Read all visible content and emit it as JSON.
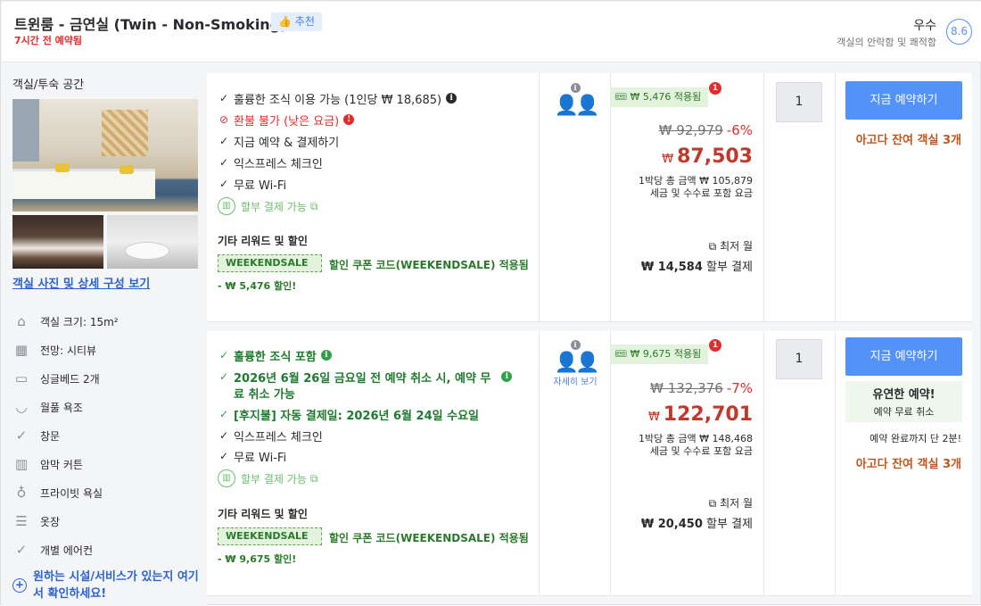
{
  "header": {
    "room_title": "트윈룸 - 금연실 (Twin - Non-Smoking)",
    "recommend_label": "추천",
    "booked_text": "7시간 전 예약됨",
    "score_word": "우수",
    "score_desc": "객실의 안락함 및 쾌적함",
    "score_value": "8.6"
  },
  "sidebar": {
    "title": "객실/투숙 공간",
    "see_photos": "객실 사진 및 상세 구성 보기",
    "features": [
      {
        "icon": "house-icon",
        "label": "객실 크기: 15m²"
      },
      {
        "icon": "city-view-icon",
        "label": "전망: 시티뷰"
      },
      {
        "icon": "bed-icon",
        "label": "싱글베드 2개"
      },
      {
        "icon": "bathtub-icon",
        "label": "월풀 욕조"
      },
      {
        "icon": "check-circle-icon",
        "label": "창문"
      },
      {
        "icon": "curtain-icon",
        "label": "암막 커튼"
      },
      {
        "icon": "toilet-icon",
        "label": "프라이빗 욕실"
      },
      {
        "icon": "wardrobe-icon",
        "label": "옷장"
      },
      {
        "icon": "check-circle-icon",
        "label": "개별 에어컨"
      }
    ],
    "ask_text": "원하는 시설/서비스가 있는지 여기서 확인하세요!"
  },
  "offers": [
    {
      "benefits": [
        {
          "mark": "✓",
          "text": "훌륭한 조식 이용 가능 (1인당 ₩ 18,685)",
          "style": "normal",
          "info": "dark"
        },
        {
          "mark": "⊘",
          "text": "환불 불가 (낮은 요금)",
          "style": "red",
          "info": "red"
        },
        {
          "mark": "✓",
          "text": "지금 예약 & 결제하기",
          "style": "normal",
          "info": ""
        },
        {
          "mark": "✓",
          "text": "익스프레스 체크인",
          "style": "normal",
          "info": ""
        },
        {
          "mark": "✓",
          "text": "무료 Wi-Fi",
          "style": "normal",
          "info": ""
        }
      ],
      "installment": "할부 결제 가능",
      "other_rewards": "기타 리워드 및 할인",
      "coupon_code": "WEEKENDSALE",
      "coupon_text": "할인 쿠폰 코드(WEEKENDSALE) 적용됨",
      "discount_text": "- ₩ 5,476 할인!",
      "occupancy_detail": "",
      "promo_label": "₩ 5,476 적용됨",
      "promo_count": "1",
      "original_price": "₩ 92,979",
      "discount_pct": "-6%",
      "currency": "₩",
      "price": "87,503",
      "price_note_1": "1박당 총 금액 ₩ 105,879",
      "price_note_2": "세금 및 수수료 포함 요금",
      "monthly_label": "최저 월",
      "monthly_amount": "₩ 14,584",
      "monthly_suffix": "할부 결제",
      "quantity": "1",
      "book_label": "지금 예약하기",
      "rooms_left": "아고다 잔여 객실 3개"
    },
    {
      "benefits": [
        {
          "mark": "✓",
          "text": "훌륭한 조식 포함",
          "style": "green",
          "info": "green"
        },
        {
          "mark": "✓",
          "text": "2026년 6월 26일 금요일 전 예약 취소 시, 예약 무",
          "style": "green",
          "info": "green"
        },
        {
          "mark": "",
          "text": "료 취소 가능",
          "style": "green",
          "info": ""
        },
        {
          "mark": "✓",
          "text": "[후지불] 자동 결제일: 2026년 6월 24일 수요일",
          "style": "green",
          "info": ""
        },
        {
          "mark": "✓",
          "text": "익스프레스 체크인",
          "style": "normal",
          "info": ""
        },
        {
          "mark": "✓",
          "text": "무료 Wi-Fi",
          "style": "normal",
          "info": ""
        }
      ],
      "installment": "할부 결제 가능",
      "other_rewards": "기타 리워드 및 할인",
      "coupon_code": "WEEKENDSALE",
      "coupon_text": "할인 쿠폰 코드(WEEKENDSALE) 적용됨",
      "discount_text": "- ₩ 9,675 할인!",
      "occupancy_detail": "자세히 보기",
      "promo_label": "₩ 9,675 적용됨",
      "promo_count": "1",
      "original_price": "₩ 132,376",
      "discount_pct": "-7%",
      "currency": "₩",
      "price": "122,701",
      "price_note_1": "1박당 총 금액 ₩ 148,468",
      "price_note_2": "세금 및 수수료 포함 요금",
      "monthly_label": "최저 월",
      "monthly_amount": "₩ 20,450",
      "monthly_suffix": "할부 결제",
      "quantity": "1",
      "book_label": "지금 예약하기",
      "flex_title": "유연한 예약!",
      "flex_sub": "예약 무료 취소",
      "only_left": "예약 완료까지 단 2분!",
      "rooms_left": "아고다 잔여 객실 3개"
    }
  ],
  "colors": {
    "accent": "#5392f9",
    "price": "#c0392b",
    "green": "#2b7a2b",
    "urgent": "#c0561c"
  }
}
